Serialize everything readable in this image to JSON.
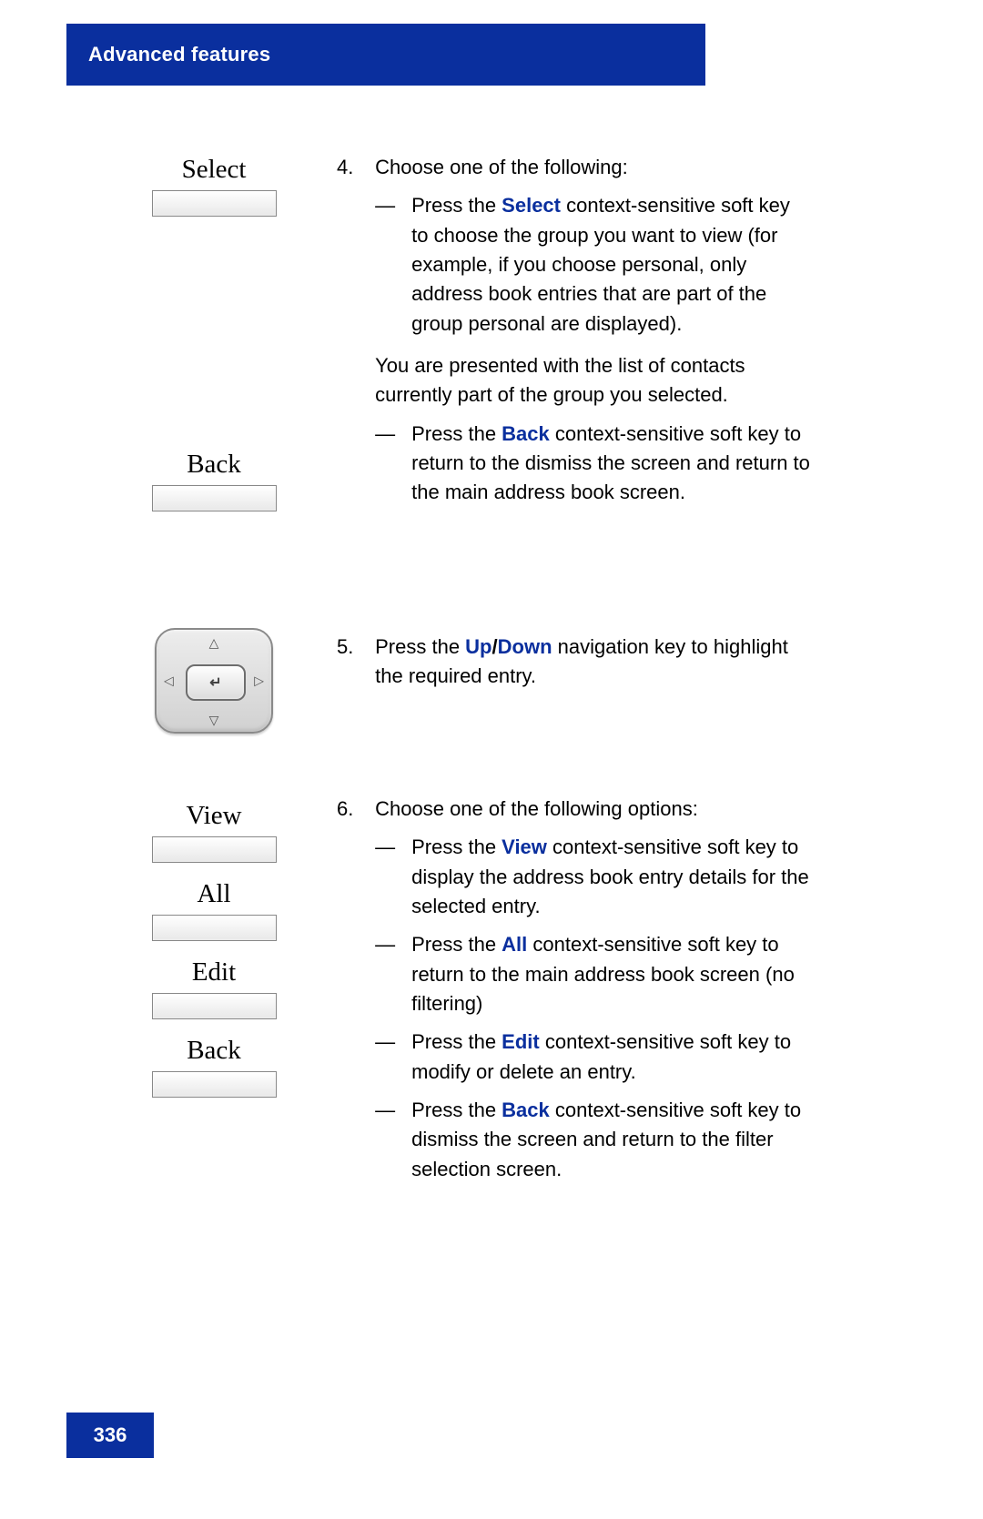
{
  "header": {
    "title": "Advanced features"
  },
  "page_number": "336",
  "softkeys": {
    "select": "Select",
    "back1": "Back",
    "view": "View",
    "all": "All",
    "edit": "Edit",
    "back2": "Back"
  },
  "steps": {
    "s4": {
      "num": "4.",
      "intro": "Choose one of the following:",
      "bullet1_pre": "Press the ",
      "bullet1_kw": "Select",
      "bullet1_post": " context-sensitive soft key to choose the group you want to view (for example, if you choose personal, only address book entries that are part of the group personal are displayed).",
      "mid": "You are presented with the list of contacts currently part of the group you selected.",
      "bullet2_pre": "Press the ",
      "bullet2_kw": "Back",
      "bullet2_post": " context-sensitive soft key to return to the dismiss the screen and return to the main address book screen."
    },
    "s5": {
      "num": "5.",
      "pre": "Press the ",
      "kw1": "Up",
      "slash": "/",
      "kw2": "Down",
      "post": " navigation key to highlight the required entry."
    },
    "s6": {
      "num": "6.",
      "intro": "Choose one of the following options:",
      "b1_pre": "Press the ",
      "b1_kw": "View",
      "b1_post": " context-sensitive soft key to display the address book entry details for the selected entry.",
      "b2_pre": "Press the ",
      "b2_kw": "All",
      "b2_post": " context-sensitive soft key to return to the main address book screen (no filtering)",
      "b3_pre": "Press the ",
      "b3_kw": "Edit",
      "b3_post": " context-sensitive soft key to modify or delete an entry.",
      "b4_pre": "Press the ",
      "b4_kw": "Back",
      "b4_post": " context-sensitive soft key to dismiss the screen and return to the filter selection screen."
    }
  },
  "navpad": {
    "enter_glyph": "↵"
  }
}
